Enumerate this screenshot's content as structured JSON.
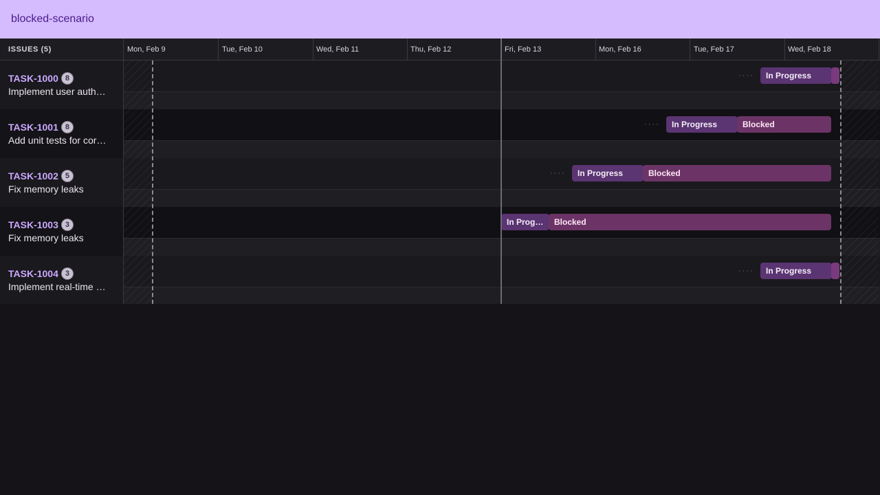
{
  "app": {
    "title": "blocked-scenario"
  },
  "header": {
    "issues_label": "ISSUES (5)",
    "days": [
      "Mon, Feb 9",
      "Tue, Feb 10",
      "Wed, Feb 11",
      "Thu, Feb 12",
      "Fri, Feb 13",
      "Mon, Feb 16",
      "Tue, Feb 17",
      "Wed, Feb 18"
    ]
  },
  "rows": [
    {
      "id": "TASK-1000",
      "count": "8",
      "title": "Implement user authentication",
      "segments": [
        {
          "label": "In Progress"
        }
      ]
    },
    {
      "id": "TASK-1001",
      "count": "8",
      "title": "Add unit tests for core modules",
      "segments": [
        {
          "label": "In Progress"
        },
        {
          "label": "Blocked"
        }
      ]
    },
    {
      "id": "TASK-1002",
      "count": "5",
      "title": "Fix memory leaks",
      "segments": [
        {
          "label": "In Progress"
        },
        {
          "label": "Blocked"
        }
      ]
    },
    {
      "id": "TASK-1003",
      "count": "3",
      "title": "Fix memory leaks",
      "segments": [
        {
          "label": "In Prog…"
        },
        {
          "label": "Blocked"
        }
      ]
    },
    {
      "id": "TASK-1004",
      "count": "3",
      "title": "Implement real-time notifications",
      "segments": [
        {
          "label": "In Progress"
        }
      ]
    }
  ],
  "colors": {
    "accent": "#d4bcff",
    "in_progress": "#5b3472",
    "blocked": "#6c3466"
  }
}
